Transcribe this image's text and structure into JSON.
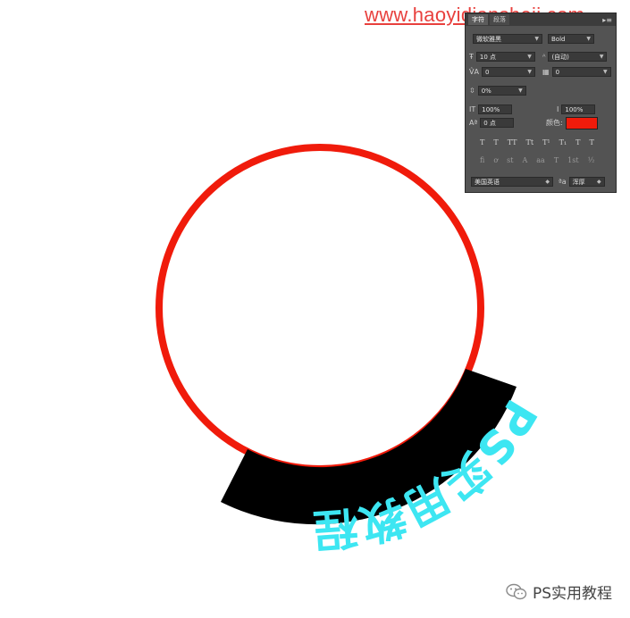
{
  "watermark": {
    "url": "www.haoyidiansheji.com"
  },
  "arc_text": {
    "text": "PS实用教程",
    "fill": "#3de6f2",
    "band": "#000000"
  },
  "ring": {
    "color": "#f01b0b"
  },
  "panel": {
    "tabs": [
      "字符",
      "段落"
    ],
    "menu": "▸≡",
    "font_family": "微软雅黑",
    "font_style": "Bold",
    "size": "10 点",
    "leading": "(自动)",
    "kerning": "0",
    "tracking": "0",
    "shift": "0%",
    "v_scale": "100%",
    "h_scale": "100%",
    "baseline": "0 点",
    "color_label": "颜色:",
    "color": "#f01b0b",
    "style_buttons": [
      "T",
      "T",
      "TT",
      "Tt",
      "T¹",
      "T₁",
      "T",
      "T"
    ],
    "opentype_buttons": [
      "fi",
      "ơ",
      "st",
      "A",
      "aa",
      "T",
      "1st",
      "½"
    ],
    "language": "美国英语",
    "aa_label": "ªa",
    "antialias": "浑厚"
  },
  "brand": {
    "name": "PS实用教程"
  }
}
